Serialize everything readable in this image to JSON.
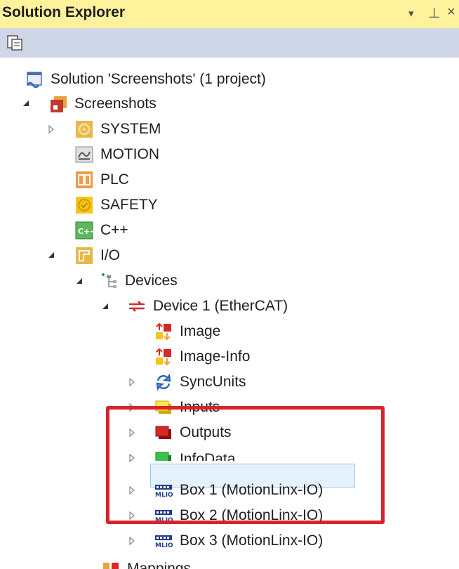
{
  "panel": {
    "title": "Solution Explorer",
    "controls": {
      "dropdown": "▾",
      "pin": "⊥",
      "close": "×"
    }
  },
  "toolbar": {
    "icon": "properties-icon"
  },
  "tree": {
    "solution": "Solution 'Screenshots' (1 project)",
    "project": "Screenshots",
    "system": "SYSTEM",
    "motion": "MOTION",
    "plc": "PLC",
    "safety": "SAFETY",
    "cpp": "C++",
    "io": "I/O",
    "devices": "Devices",
    "device1": "Device 1 (EtherCAT)",
    "image": "Image",
    "image_info": "Image-Info",
    "syncunits": "SyncUnits",
    "inputs": "Inputs",
    "outputs": "Outputs",
    "infodata": "InfoData",
    "box1": "Box 1 (MotionLinx-IO)",
    "box2": "Box 2 (MotionLinx-IO)",
    "box3": "Box 3 (MotionLinx-IO)",
    "mappings": "Mappings"
  },
  "colors": {
    "title_bar": "#fff29d",
    "toolbar": "#cfd6e5",
    "selection": "#e5f1fb",
    "highlight_box": "#d5242c"
  }
}
